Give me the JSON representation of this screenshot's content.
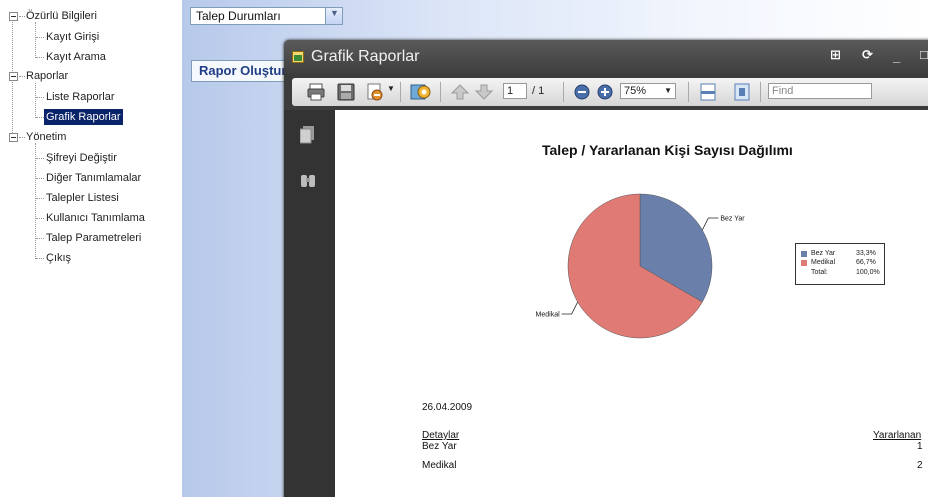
{
  "tree": {
    "groups": [
      {
        "label": "Özürlü Bilgileri",
        "children": [
          "Kayıt Girişi",
          "Kayıt Arama"
        ]
      },
      {
        "label": "Raporlar",
        "children": [
          "Liste Raporlar",
          "Grafik Raporlar"
        ]
      },
      {
        "label": "Yönetim",
        "children": [
          "Şifreyi Değiştir",
          "Diğer Tanımlamalar",
          "Talepler Listesi",
          "Kullanıcı Tanımlama",
          "Talep Parametreleri",
          "Çıkış"
        ]
      }
    ],
    "selected": "Grafik Raporlar"
  },
  "report_select": {
    "value": "Talep Durumları"
  },
  "rapor_button": {
    "label": "Rapor Oluştur"
  },
  "window": {
    "title": "Grafik Raporlar",
    "icons": [
      "pin-icon",
      "refresh-icon",
      "minimize-icon",
      "maximize-icon"
    ]
  },
  "toolbar": {
    "page_current": "1",
    "page_sep": "/ 1",
    "zoom": "75%",
    "find_placeholder": "Find",
    "icons": [
      "print-icon",
      "save-icon",
      "export-icon",
      "refresh-report-icon",
      "page-up-icon",
      "page-down-icon",
      "zoom-out-icon",
      "zoom-in-icon",
      "page-width-icon",
      "whole-page-icon"
    ]
  },
  "side_icons": [
    "document-map-icon",
    "search-binoculars-icon"
  ],
  "report": {
    "date": "26.04.2009",
    "details_header": "Detaylar",
    "value_header": "Yararlanan",
    "rows": [
      {
        "label": "Bez Yar",
        "value": "1"
      },
      {
        "label": "Medikal",
        "value": "2"
      }
    ]
  },
  "chart_data": {
    "type": "pie",
    "title": "Talep / Yararlanan Kişi Sayısı Dağılımı",
    "slices": [
      {
        "label": "Bez Yar",
        "value": 1,
        "percent": "33,3%",
        "color": "#6a7faa"
      },
      {
        "label": "Medikal",
        "value": 2,
        "percent": "66,7%",
        "color": "#e07a74"
      }
    ],
    "legend": {
      "position": "right",
      "total_label": "Total:",
      "total_value": "100,0%"
    }
  }
}
